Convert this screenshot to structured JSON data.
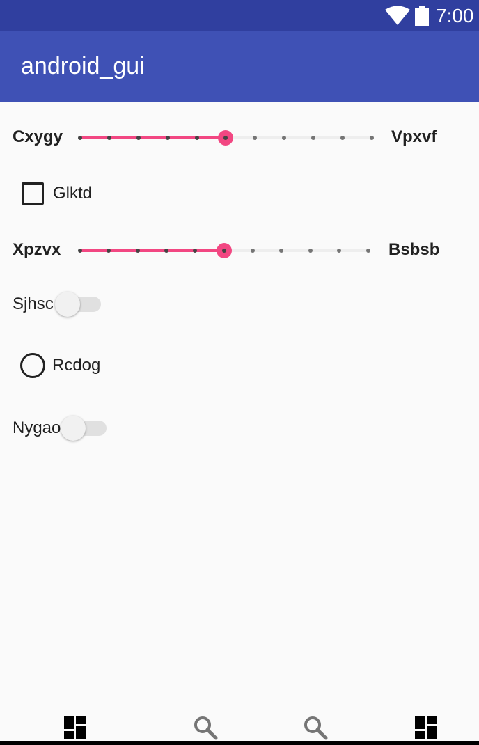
{
  "status_bar": {
    "time": "7:00",
    "icons": [
      "wifi-icon",
      "battery-icon"
    ],
    "background": "#303f9f"
  },
  "app_bar": {
    "title": "android_gui",
    "background": "#3f51b5"
  },
  "content": {
    "slider1": {
      "left_label": "Cxygy",
      "right_label": "Vpxvf",
      "steps": 10,
      "value": 5
    },
    "checkbox": {
      "label": "Glktd",
      "checked": false
    },
    "slider2": {
      "left_label": "Xpzvx",
      "right_label": "Bsbsb",
      "steps": 10,
      "value": 5
    },
    "switch1": {
      "label": "Sjhsc",
      "on": false
    },
    "radio": {
      "label": "Rcdog",
      "selected": false
    },
    "switch2": {
      "label": "Nygao",
      "on": false
    }
  },
  "bottom_nav": {
    "items": [
      "dashboard-icon",
      "search-icon",
      "search-icon",
      "dashboard-icon"
    ]
  },
  "colors": {
    "accent": "#f24782",
    "track": "#eeeeee",
    "tick": "#757575",
    "text": "#212121"
  }
}
